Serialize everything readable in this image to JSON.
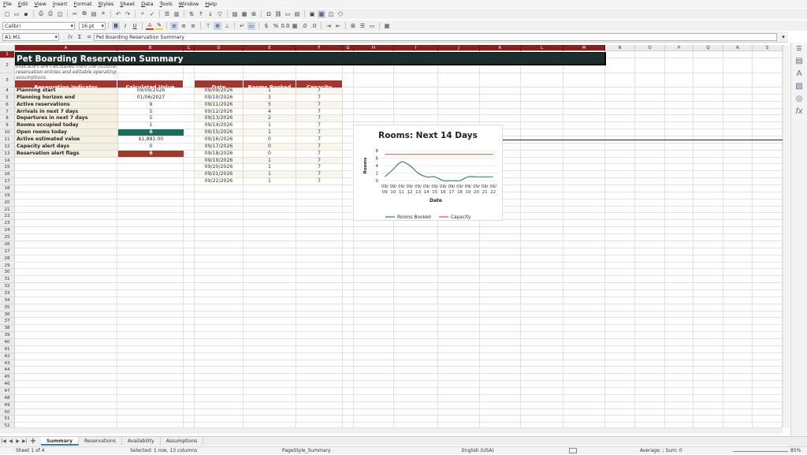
{
  "menu": [
    "File",
    "Edit",
    "View",
    "Insert",
    "Format",
    "Styles",
    "Sheet",
    "Data",
    "Tools",
    "Window",
    "Help"
  ],
  "font": {
    "name": "Calibri",
    "size": "16 pt"
  },
  "namebox": "A1:M1",
  "formula_content": "Pet Boarding Reservation Summary",
  "columns": [
    "A",
    "B",
    "C",
    "D",
    "E",
    "F",
    "G",
    "H",
    "I",
    "J",
    "K",
    "L",
    "M",
    "N",
    "O",
    "P",
    "Q",
    "R",
    "S"
  ],
  "sheet": {
    "title": "Pet Boarding Reservation Summary",
    "note": "Indicators are calculated from the fictional reservation entries and editable operating assumptions.",
    "indicator_header": "Reservation Indicator",
    "value_header": "Calculated Value",
    "indicators": [
      {
        "label": "Planning start",
        "value": "09/09/2026",
        "style": ""
      },
      {
        "label": "Planning horizon end",
        "value": "01/06/2027",
        "style": ""
      },
      {
        "label": "Active reservations",
        "value": "9",
        "style": ""
      },
      {
        "label": "Arrivals in next 7 days",
        "value": "5",
        "style": ""
      },
      {
        "label": "Departures in next 7 days",
        "value": "5",
        "style": ""
      },
      {
        "label": "Rooms occupied today",
        "value": "1",
        "style": ""
      },
      {
        "label": "Open rooms today",
        "value": "6",
        "style": "teal"
      },
      {
        "label": "Active estimated value",
        "value": "$1,881.00",
        "style": ""
      },
      {
        "label": "Capacity alert days",
        "value": "0",
        "style": ""
      },
      {
        "label": "Reservation alert flags",
        "value": "6",
        "style": "red"
      }
    ],
    "schedule_headers": [
      "Date",
      "Rooms Booked",
      "Capacity"
    ],
    "schedule": [
      {
        "date": "09/09/2026",
        "booked": "1",
        "capacity": "7"
      },
      {
        "date": "09/10/2026",
        "booked": "3",
        "capacity": "7"
      },
      {
        "date": "09/11/2026",
        "booked": "5",
        "capacity": "7"
      },
      {
        "date": "09/12/2026",
        "booked": "4",
        "capacity": "7"
      },
      {
        "date": "09/13/2026",
        "booked": "2",
        "capacity": "7"
      },
      {
        "date": "09/14/2026",
        "booked": "1",
        "capacity": "7"
      },
      {
        "date": "09/15/2026",
        "booked": "1",
        "capacity": "7"
      },
      {
        "date": "09/16/2026",
        "booked": "0",
        "capacity": "7"
      },
      {
        "date": "09/17/2026",
        "booked": "0",
        "capacity": "7"
      },
      {
        "date": "09/18/2026",
        "booked": "0",
        "capacity": "7"
      },
      {
        "date": "09/19/2026",
        "booked": "1",
        "capacity": "7"
      },
      {
        "date": "09/20/2026",
        "booked": "1",
        "capacity": "7"
      },
      {
        "date": "09/21/2026",
        "booked": "1",
        "capacity": "7"
      },
      {
        "date": "09/22/2026",
        "booked": "1",
        "capacity": "7"
      }
    ]
  },
  "chart_data": {
    "type": "line",
    "title": "Rooms: Next 14 Days",
    "xlabel": "Date",
    "ylabel": "Rooms",
    "categories": [
      "09/09",
      "09/10",
      "09/11",
      "09/12",
      "09/13",
      "09/14",
      "09/15",
      "09/16",
      "09/17",
      "09/18",
      "09/19",
      "09/20",
      "09/21",
      "09/22"
    ],
    "series": [
      {
        "name": "Rooms Booked",
        "values": [
          1,
          3,
          5,
          4,
          2,
          1,
          1,
          0,
          0,
          0,
          1,
          1,
          1,
          1
        ],
        "color": "#2e7d5f"
      },
      {
        "name": "Capacity",
        "values": [
          7,
          7,
          7,
          7,
          7,
          7,
          7,
          7,
          7,
          7,
          7,
          7,
          7,
          7
        ],
        "color": "#d0544a"
      }
    ],
    "yticks": [
      "0",
      "2",
      "4",
      "6",
      "8"
    ],
    "ylim": [
      0,
      8
    ],
    "grid": true,
    "legend": "bottom"
  },
  "tabs": [
    "Summary",
    "Reservations",
    "Availability",
    "Assumptions"
  ],
  "active_tab": "Summary",
  "status": {
    "sheet": "Sheet 1 of 4",
    "selection": "Selected: 1 row, 13 columns",
    "style": "PageStyle_Summary",
    "language": "English (USA)",
    "sum": "Average: ; Sum: 0",
    "zoom": "85%"
  },
  "colors": {
    "accent": "#a4372b",
    "title_bg": "#1d2f2c",
    "teal": "#1f6b5a"
  }
}
